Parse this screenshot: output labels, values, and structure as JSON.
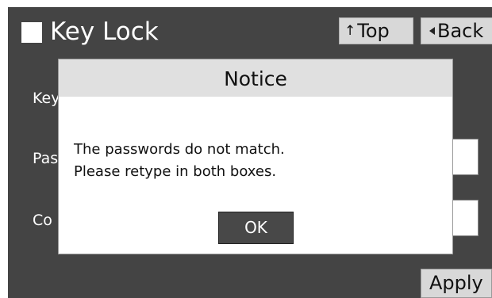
{
  "header": {
    "title": "Key Lock",
    "top_button": "Top",
    "back_button": "Back"
  },
  "form": {
    "key_label": "Key",
    "password_label": "Pas",
    "confirm_label": "Co"
  },
  "footer": {
    "apply_button": "Apply"
  },
  "dialog": {
    "title": "Notice",
    "message_line1": "The passwords do not match.",
    "message_line2": "Please retype in both boxes.",
    "ok_button": "OK"
  },
  "icons": {
    "title_marker": "square-icon",
    "top_arrow": "arrow-up-icon",
    "back_arrow": "triangle-left-icon"
  },
  "colors": {
    "screen_background": "#444444",
    "dialog_background": "#ffffff",
    "dialog_header": "#e0e0e0",
    "button_light": "#d8d8d8",
    "button_dark": "#484848"
  }
}
